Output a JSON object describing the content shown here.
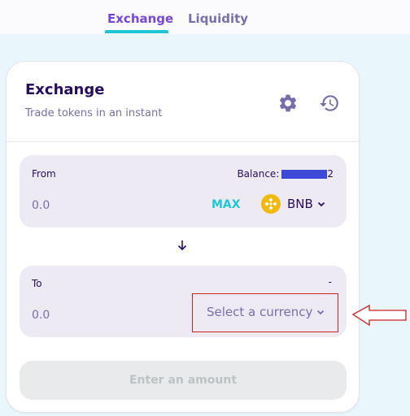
{
  "nav": {
    "tabs": [
      {
        "label": "Exchange",
        "active": true
      },
      {
        "label": "Liquidity",
        "active": false
      }
    ]
  },
  "card": {
    "title": "Exchange",
    "subtitle": "Trade tokens in an instant",
    "icons": [
      "settings-gear-icon",
      "history-icon"
    ]
  },
  "from": {
    "label": "From",
    "balance_label": "Balance:",
    "balance_suffix": "2",
    "amount": "0.0",
    "max_label": "MAX",
    "token": "BNB"
  },
  "to": {
    "label": "To",
    "balance_dash": "-",
    "amount": "0.0",
    "select_label": "Select a currency"
  },
  "action": {
    "button_label": "Enter an amount"
  },
  "colors": {
    "accent": "#1fc7d4",
    "primary_text": "#280d5f",
    "secondary_text": "#7a6eaa",
    "active_tab": "#7645d9",
    "highlight": "#cc2222"
  }
}
